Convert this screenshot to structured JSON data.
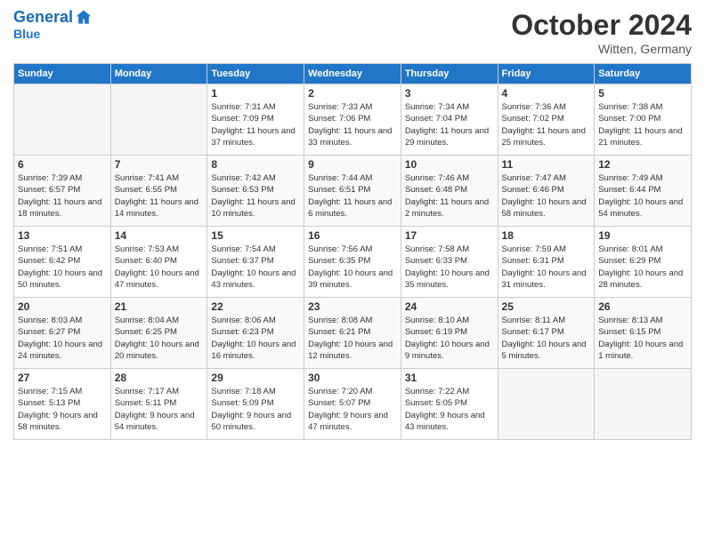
{
  "header": {
    "logo_line1": "General",
    "logo_line2": "Blue",
    "month_title": "October 2024",
    "location": "Witten, Germany"
  },
  "weekdays": [
    "Sunday",
    "Monday",
    "Tuesday",
    "Wednesday",
    "Thursday",
    "Friday",
    "Saturday"
  ],
  "weeks": [
    [
      {
        "day": "",
        "sunrise": "",
        "sunset": "",
        "daylight": "",
        "empty": true
      },
      {
        "day": "",
        "sunrise": "",
        "sunset": "",
        "daylight": "",
        "empty": true
      },
      {
        "day": "1",
        "sunrise": "Sunrise: 7:31 AM",
        "sunset": "Sunset: 7:09 PM",
        "daylight": "Daylight: 11 hours and 37 minutes."
      },
      {
        "day": "2",
        "sunrise": "Sunrise: 7:33 AM",
        "sunset": "Sunset: 7:06 PM",
        "daylight": "Daylight: 11 hours and 33 minutes."
      },
      {
        "day": "3",
        "sunrise": "Sunrise: 7:34 AM",
        "sunset": "Sunset: 7:04 PM",
        "daylight": "Daylight: 11 hours and 29 minutes."
      },
      {
        "day": "4",
        "sunrise": "Sunrise: 7:36 AM",
        "sunset": "Sunset: 7:02 PM",
        "daylight": "Daylight: 11 hours and 25 minutes."
      },
      {
        "day": "5",
        "sunrise": "Sunrise: 7:38 AM",
        "sunset": "Sunset: 7:00 PM",
        "daylight": "Daylight: 11 hours and 21 minutes."
      }
    ],
    [
      {
        "day": "6",
        "sunrise": "Sunrise: 7:39 AM",
        "sunset": "Sunset: 6:57 PM",
        "daylight": "Daylight: 11 hours and 18 minutes."
      },
      {
        "day": "7",
        "sunrise": "Sunrise: 7:41 AM",
        "sunset": "Sunset: 6:55 PM",
        "daylight": "Daylight: 11 hours and 14 minutes."
      },
      {
        "day": "8",
        "sunrise": "Sunrise: 7:42 AM",
        "sunset": "Sunset: 6:53 PM",
        "daylight": "Daylight: 11 hours and 10 minutes."
      },
      {
        "day": "9",
        "sunrise": "Sunrise: 7:44 AM",
        "sunset": "Sunset: 6:51 PM",
        "daylight": "Daylight: 11 hours and 6 minutes."
      },
      {
        "day": "10",
        "sunrise": "Sunrise: 7:46 AM",
        "sunset": "Sunset: 6:48 PM",
        "daylight": "Daylight: 11 hours and 2 minutes."
      },
      {
        "day": "11",
        "sunrise": "Sunrise: 7:47 AM",
        "sunset": "Sunset: 6:46 PM",
        "daylight": "Daylight: 10 hours and 58 minutes."
      },
      {
        "day": "12",
        "sunrise": "Sunrise: 7:49 AM",
        "sunset": "Sunset: 6:44 PM",
        "daylight": "Daylight: 10 hours and 54 minutes."
      }
    ],
    [
      {
        "day": "13",
        "sunrise": "Sunrise: 7:51 AM",
        "sunset": "Sunset: 6:42 PM",
        "daylight": "Daylight: 10 hours and 50 minutes."
      },
      {
        "day": "14",
        "sunrise": "Sunrise: 7:53 AM",
        "sunset": "Sunset: 6:40 PM",
        "daylight": "Daylight: 10 hours and 47 minutes."
      },
      {
        "day": "15",
        "sunrise": "Sunrise: 7:54 AM",
        "sunset": "Sunset: 6:37 PM",
        "daylight": "Daylight: 10 hours and 43 minutes."
      },
      {
        "day": "16",
        "sunrise": "Sunrise: 7:56 AM",
        "sunset": "Sunset: 6:35 PM",
        "daylight": "Daylight: 10 hours and 39 minutes."
      },
      {
        "day": "17",
        "sunrise": "Sunrise: 7:58 AM",
        "sunset": "Sunset: 6:33 PM",
        "daylight": "Daylight: 10 hours and 35 minutes."
      },
      {
        "day": "18",
        "sunrise": "Sunrise: 7:59 AM",
        "sunset": "Sunset: 6:31 PM",
        "daylight": "Daylight: 10 hours and 31 minutes."
      },
      {
        "day": "19",
        "sunrise": "Sunrise: 8:01 AM",
        "sunset": "Sunset: 6:29 PM",
        "daylight": "Daylight: 10 hours and 28 minutes."
      }
    ],
    [
      {
        "day": "20",
        "sunrise": "Sunrise: 8:03 AM",
        "sunset": "Sunset: 6:27 PM",
        "daylight": "Daylight: 10 hours and 24 minutes."
      },
      {
        "day": "21",
        "sunrise": "Sunrise: 8:04 AM",
        "sunset": "Sunset: 6:25 PM",
        "daylight": "Daylight: 10 hours and 20 minutes."
      },
      {
        "day": "22",
        "sunrise": "Sunrise: 8:06 AM",
        "sunset": "Sunset: 6:23 PM",
        "daylight": "Daylight: 10 hours and 16 minutes."
      },
      {
        "day": "23",
        "sunrise": "Sunrise: 8:08 AM",
        "sunset": "Sunset: 6:21 PM",
        "daylight": "Daylight: 10 hours and 12 minutes."
      },
      {
        "day": "24",
        "sunrise": "Sunrise: 8:10 AM",
        "sunset": "Sunset: 6:19 PM",
        "daylight": "Daylight: 10 hours and 9 minutes."
      },
      {
        "day": "25",
        "sunrise": "Sunrise: 8:11 AM",
        "sunset": "Sunset: 6:17 PM",
        "daylight": "Daylight: 10 hours and 5 minutes."
      },
      {
        "day": "26",
        "sunrise": "Sunrise: 8:13 AM",
        "sunset": "Sunset: 6:15 PM",
        "daylight": "Daylight: 10 hours and 1 minute."
      }
    ],
    [
      {
        "day": "27",
        "sunrise": "Sunrise: 7:15 AM",
        "sunset": "Sunset: 5:13 PM",
        "daylight": "Daylight: 9 hours and 58 minutes."
      },
      {
        "day": "28",
        "sunrise": "Sunrise: 7:17 AM",
        "sunset": "Sunset: 5:11 PM",
        "daylight": "Daylight: 9 hours and 54 minutes."
      },
      {
        "day": "29",
        "sunrise": "Sunrise: 7:18 AM",
        "sunset": "Sunset: 5:09 PM",
        "daylight": "Daylight: 9 hours and 50 minutes."
      },
      {
        "day": "30",
        "sunrise": "Sunrise: 7:20 AM",
        "sunset": "Sunset: 5:07 PM",
        "daylight": "Daylight: 9 hours and 47 minutes."
      },
      {
        "day": "31",
        "sunrise": "Sunrise: 7:22 AM",
        "sunset": "Sunset: 5:05 PM",
        "daylight": "Daylight: 9 hours and 43 minutes."
      },
      {
        "day": "",
        "sunrise": "",
        "sunset": "",
        "daylight": "",
        "empty": true
      },
      {
        "day": "",
        "sunrise": "",
        "sunset": "",
        "daylight": "",
        "empty": true
      }
    ]
  ]
}
